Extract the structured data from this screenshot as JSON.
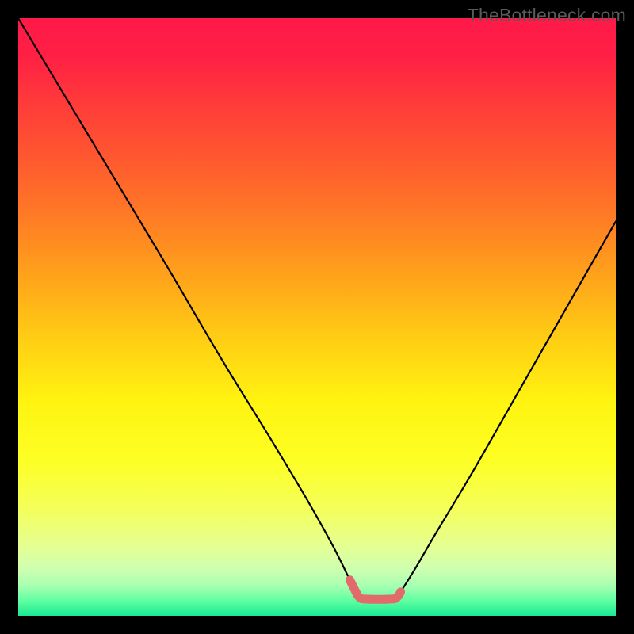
{
  "watermark": "TheBottleneck.com",
  "chart_data": {
    "type": "line",
    "title": "",
    "xlabel": "",
    "ylabel": "",
    "xlim": [
      0,
      100
    ],
    "ylim": [
      0,
      100
    ],
    "grid": false,
    "legend": false,
    "series": [
      {
        "name": "black-curve",
        "color": "#000000",
        "x": [
          0.0,
          12.0,
          24.0,
          34.0,
          42.0,
          48.0,
          52.5,
          55.5,
          56.5,
          57.0,
          58.0,
          62.5,
          63.5,
          64.0,
          66.5,
          70.0,
          76.0,
          84.0,
          92.0,
          100.0
        ],
        "y": [
          100.0,
          80.0,
          60.0,
          43.0,
          30.0,
          20.0,
          12.0,
          6.0,
          4.0,
          3.2,
          2.8,
          2.8,
          3.2,
          4.0,
          8.0,
          14.0,
          24.0,
          38.0,
          52.0,
          66.0
        ]
      },
      {
        "name": "red-flat-highlight",
        "color": "#e26a6a",
        "x": [
          55.5,
          56.5,
          57.0,
          58.0,
          62.5,
          63.5,
          64.0
        ],
        "y": [
          6.0,
          4.0,
          3.2,
          2.8,
          2.8,
          3.2,
          4.0
        ]
      }
    ],
    "background_gradient": {
      "stops": [
        {
          "offset": 0.0,
          "color": "#ff1949"
        },
        {
          "offset": 0.06,
          "color": "#ff1f45"
        },
        {
          "offset": 0.14,
          "color": "#ff3a3a"
        },
        {
          "offset": 0.24,
          "color": "#ff5a2f"
        },
        {
          "offset": 0.34,
          "color": "#ff7e24"
        },
        {
          "offset": 0.44,
          "color": "#ffa61a"
        },
        {
          "offset": 0.54,
          "color": "#ffcf14"
        },
        {
          "offset": 0.64,
          "color": "#fff310"
        },
        {
          "offset": 0.74,
          "color": "#fdff24"
        },
        {
          "offset": 0.82,
          "color": "#f4ff5a"
        },
        {
          "offset": 0.88,
          "color": "#e6ff8f"
        },
        {
          "offset": 0.92,
          "color": "#d0ffb0"
        },
        {
          "offset": 0.95,
          "color": "#a7ffb1"
        },
        {
          "offset": 0.975,
          "color": "#5effa1"
        },
        {
          "offset": 1.0,
          "color": "#19e992"
        }
      ]
    }
  }
}
